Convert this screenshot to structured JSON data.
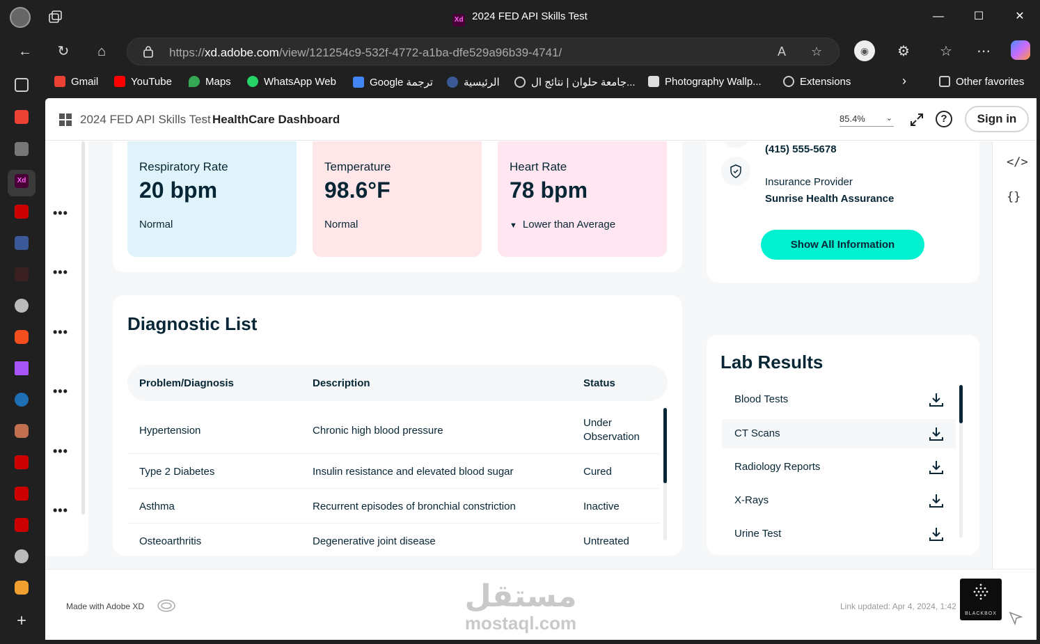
{
  "browser": {
    "window_title": "2024 FED API Skills Test",
    "url_prefix": "https://",
    "url_domain": "xd.adobe.com",
    "url_path": "/view/121254c9-532f-4772-a1ba-dfe529a96b39-4741/",
    "bookmarks": [
      {
        "label": "Gmail",
        "color": "#ea4335"
      },
      {
        "label": "YouTube",
        "color": "#ff0000"
      },
      {
        "label": "Maps",
        "color": "#34a853"
      },
      {
        "label": "WhatsApp Web",
        "color": "#25d366"
      },
      {
        "label": "Google ترجمة",
        "color": "#4285f4"
      },
      {
        "label": "الرئيسية",
        "color": "#3b5998"
      },
      {
        "label": "جامعة حلوان | نتائج ال...",
        "color": "#888888"
      },
      {
        "label": "Photography Wallp...",
        "color": "#dddddd"
      },
      {
        "label": "Extensions",
        "color": "#888888"
      }
    ],
    "other_favorites": "Other favorites"
  },
  "xd": {
    "breadcrumb_project": "2024 FED API Skills Test",
    "breadcrumb_page": "HealthCare Dashboard",
    "zoom": "85.4%",
    "help": "?",
    "sign_in": "Sign in",
    "made_with": "Made with Adobe XD",
    "link_updated": "Link updated: Apr 4, 2024, 1:42",
    "watermark_ar": "مستقل",
    "watermark_en": "mostaql.com",
    "blackbox": "BLACKBOX"
  },
  "vitals": [
    {
      "label": "Respiratory Rate",
      "value": "20 bpm",
      "status": "Normal",
      "bg": "#e0f3fa"
    },
    {
      "label": "Temperature",
      "value": "98.6°F",
      "status": "Normal",
      "bg": "#ffe6e9"
    },
    {
      "label": "Heart Rate",
      "value": "78 bpm",
      "status": "Lower than Average",
      "bg": "#ffe6f1"
    }
  ],
  "diagnostic": {
    "title": "Diagnostic List",
    "headers": [
      "Problem/Diagnosis",
      "Description",
      "Status"
    ],
    "rows": [
      [
        "Hypertension",
        "Chronic high blood pressure",
        "Under Observation"
      ],
      [
        "Type 2 Diabetes",
        "Insulin resistance and elevated blood sugar",
        "Cured"
      ],
      [
        "Asthma",
        "Recurrent episodes of bronchial constriction",
        "Inactive"
      ],
      [
        "Osteoarthritis",
        "Degenerative joint disease",
        "Untreated"
      ]
    ]
  },
  "patient_info": {
    "phone": "(415) 555-5678",
    "insurance_label": "Insurance Provider",
    "insurance_value": "Sunrise Health Assurance",
    "show_all": "Show All Information"
  },
  "lab": {
    "title": "Lab Results",
    "items": [
      "Blood Tests",
      "CT Scans",
      "Radiology Reports",
      "X-Rays",
      "Urine Test"
    ]
  }
}
